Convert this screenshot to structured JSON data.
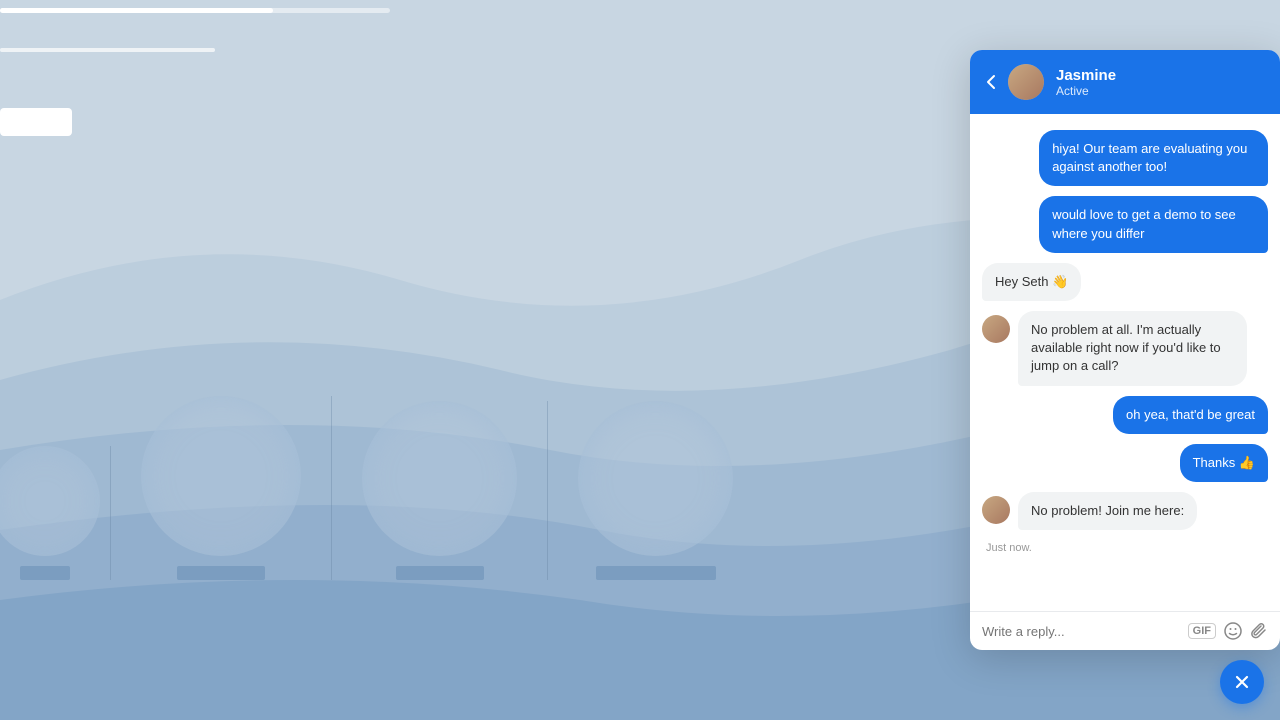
{
  "background": {
    "color": "#c5d3e0"
  },
  "progress_bar": {
    "fill_percent": 70
  },
  "left_content": {
    "search_placeholder": ""
  },
  "cards": [
    {
      "id": 1,
      "size": 130,
      "label_width": 60
    },
    {
      "id": 2,
      "size": 170,
      "label_width": 90
    },
    {
      "id": 3,
      "size": 160,
      "label_width": 90
    },
    {
      "id": 4,
      "size": 160,
      "label_width": 120
    }
  ],
  "chat": {
    "header": {
      "name": "Jasmine",
      "status": "Active",
      "back_label": "‹"
    },
    "messages": [
      {
        "id": 1,
        "type": "outgoing",
        "text": "hiya! Our team are evaluating you against another too!"
      },
      {
        "id": 2,
        "type": "outgoing",
        "text": "would love to get a demo to see where you differ"
      },
      {
        "id": 3,
        "type": "incoming-plain",
        "text": "Hey Seth 👋"
      },
      {
        "id": 4,
        "type": "incoming-avatar",
        "text": "No problem at all. I'm actually available right now if you'd like to jump on a call?"
      },
      {
        "id": 5,
        "type": "outgoing",
        "text": "oh yea, that'd be great"
      },
      {
        "id": 6,
        "type": "outgoing",
        "text": "Thanks 👍"
      },
      {
        "id": 7,
        "type": "incoming-avatar",
        "text": "No problem! Join me here:"
      },
      {
        "id": 8,
        "type": "timestamp",
        "text": "Just now."
      }
    ],
    "input": {
      "placeholder": "Write a reply...",
      "gif_label": "GIF",
      "emoji_icon": "😊",
      "attach_icon": "📎"
    },
    "fab_icon": "✕"
  }
}
